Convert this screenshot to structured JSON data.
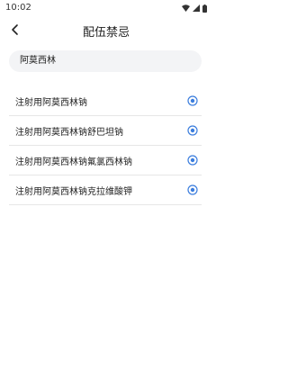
{
  "status_bar": {
    "time": "10:02"
  },
  "header": {
    "title": "配伍禁忌"
  },
  "search": {
    "value": "阿莫西林"
  },
  "results": [
    {
      "label": "注射用阿莫西林钠"
    },
    {
      "label": "注射用阿莫西林钠舒巴坦钠"
    },
    {
      "label": "注射用阿莫西林钠氟氯西林钠"
    },
    {
      "label": "注射用阿莫西林钠克拉维酸钾"
    }
  ],
  "colors": {
    "accent": "#3b7ddd",
    "divider": "#e6e6e6",
    "search_bg": "#f3f4f6"
  },
  "icons": {
    "back": "chevron-left-icon",
    "row_action": "add-circle-icon"
  }
}
